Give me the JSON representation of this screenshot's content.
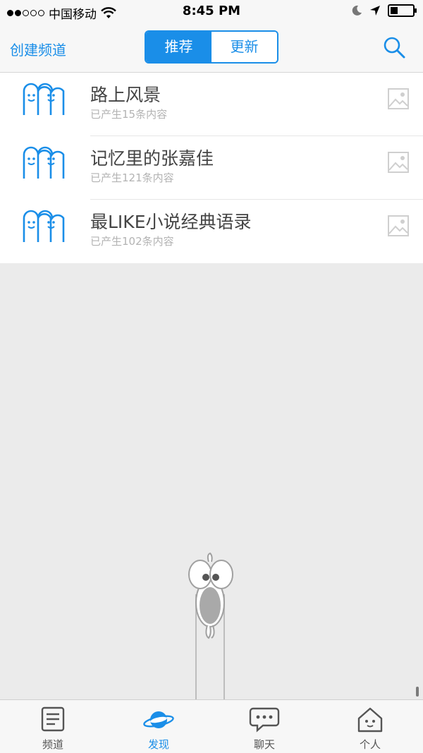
{
  "status_bar": {
    "carrier": "中国移动",
    "time": "8:45 PM",
    "signal_bars_filled": 2,
    "signal_bars_total": 5
  },
  "nav": {
    "left_label": "创建频道",
    "segments": [
      "推荐",
      "更新"
    ],
    "active_segment": 0,
    "right_icon": "search-icon"
  },
  "channels": [
    {
      "title": "路上风景",
      "subtitle": "已产生15条内容"
    },
    {
      "title": "记忆里的张嘉佳",
      "subtitle": "已产生121条内容"
    },
    {
      "title": "最LIKE小说经典语录",
      "subtitle": "已产生102条内容"
    }
  ],
  "tabs": [
    {
      "label": "频道",
      "icon": "document-icon"
    },
    {
      "label": "发现",
      "icon": "planet-icon"
    },
    {
      "label": "聊天",
      "icon": "chat-bubble-icon"
    },
    {
      "label": "个人",
      "icon": "home-face-icon"
    }
  ],
  "active_tab": 1,
  "colors": {
    "accent": "#1a8ee8",
    "background": "#ebebeb"
  }
}
